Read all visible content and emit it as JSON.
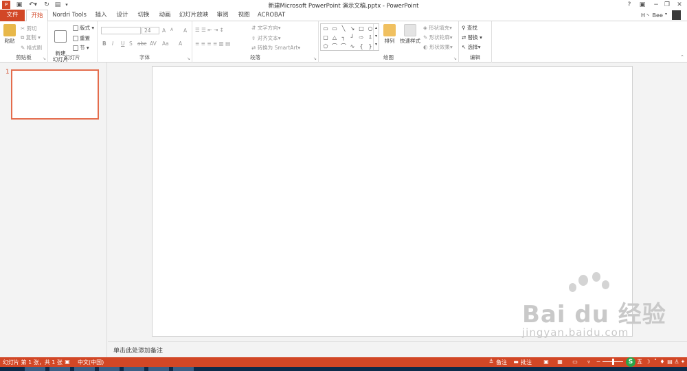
{
  "title_bar": {
    "title": "新建Microsoft PowerPoint 演示文稿.pptx - PowerPoint",
    "user": "H丶 Bee",
    "help": "?",
    "ribbon_display": "▣",
    "minimize": "−",
    "restore": "❐",
    "close": "✕",
    "quick_access": [
      "ppt-logo-icon",
      "save-icon",
      "undo-icon",
      "redo-icon",
      "present-icon",
      "customize-icon"
    ]
  },
  "tabs": [
    "文件",
    "开始",
    "Nordri Tools",
    "插入",
    "设计",
    "切换",
    "动画",
    "幻灯片放映",
    "审阅",
    "视图",
    "ACROBAT"
  ],
  "active_tab": "开始",
  "ribbon": {
    "clipboard": {
      "label": "剪贴板",
      "paste": "粘贴",
      "cut": "剪切",
      "copy": "复制",
      "format_painter": "格式刷"
    },
    "slides": {
      "label": "幻灯片",
      "new_slide": "新建\n幻灯片",
      "layout": "版式",
      "reset": "重置",
      "section": "节"
    },
    "font": {
      "label": "字体",
      "font_name": "",
      "font_size": "24",
      "grow": "A",
      "shrink": "A",
      "clear": "A",
      "bold": "B",
      "italic": "I",
      "underline": "U",
      "strike": "S",
      "shadow": "abc",
      "spacing": "AV",
      "case": "Aa",
      "color": "A"
    },
    "paragraph": {
      "label": "段落",
      "text_direction": "文字方向",
      "align_text": "对齐文本",
      "smartart": "转换为 SmartArt"
    },
    "drawing": {
      "label": "绘图",
      "arrange": "排列",
      "quick_styles": "快速样式",
      "shape_fill": "形状填充",
      "shape_outline": "形状轮廓",
      "shape_effects": "形状效果"
    },
    "editing": {
      "label": "编辑",
      "find": "查找",
      "replace": "替换",
      "select": "选择"
    }
  },
  "thumbnail": {
    "number": "1"
  },
  "notes": {
    "placeholder": "单击此处添加备注"
  },
  "status_bar": {
    "slide_info": "幻灯片 第 1 张，共 1 张",
    "language": "中文(中国)",
    "notes": "备注",
    "comments": "批注",
    "zoom_level": 0.5
  },
  "watermark": {
    "brand": "Bai du 经验",
    "url": "jingyan.baidu.com"
  },
  "colors": {
    "accent": "#d24726",
    "thumbnail_border": "#e46c4c"
  }
}
